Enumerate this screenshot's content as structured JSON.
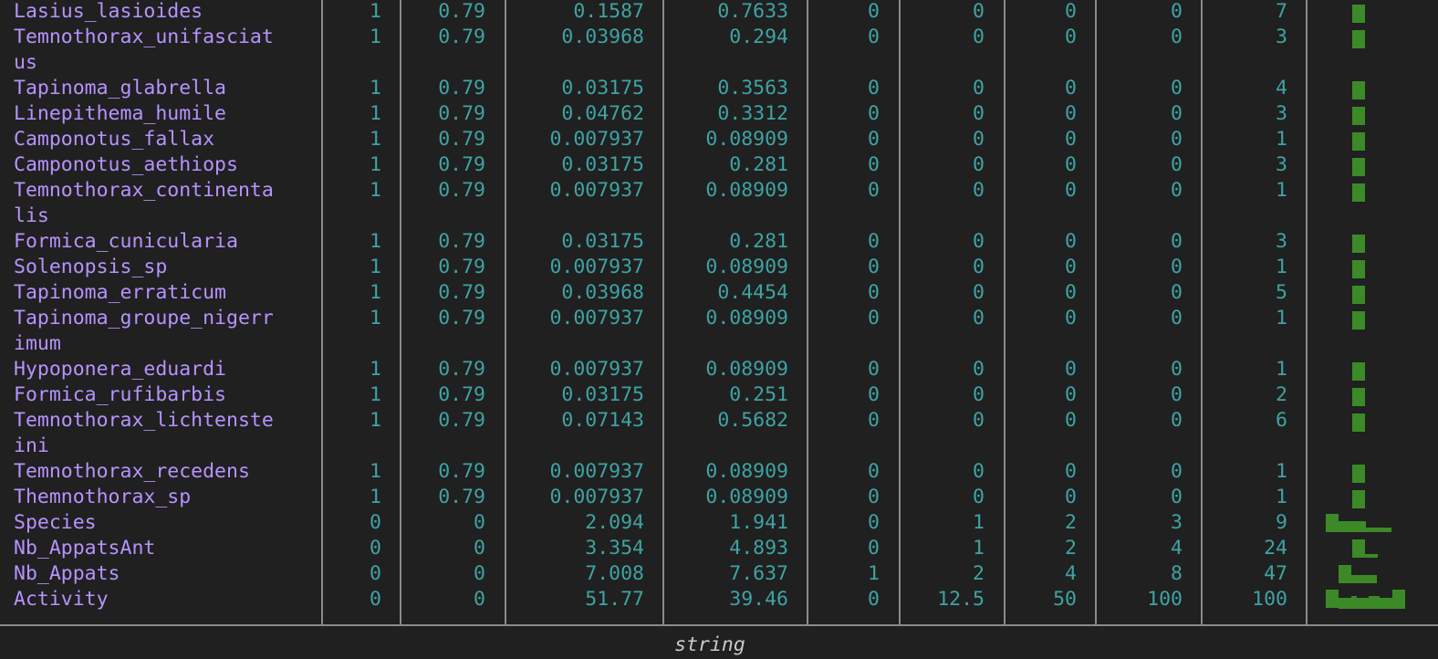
{
  "colors": {
    "background": "#202020",
    "row_label": "#b693ff",
    "numeric": "#3fa3a3",
    "histogram_bar": "#3c8a27",
    "grid_line": "#8a8a8a"
  },
  "rows": [
    {
      "name": [
        "Lasius_lasioides"
      ],
      "values": [
        "1",
        "0.79",
        "0.1587",
        "0.7633",
        "0",
        "0",
        "0",
        "0",
        "7"
      ],
      "hist": "single"
    },
    {
      "name": [
        "Temnothorax_unifasciat",
        "us"
      ],
      "values": [
        "1",
        "0.79",
        "0.03968",
        "0.294",
        "0",
        "0",
        "0",
        "0",
        "3"
      ],
      "hist": "single"
    },
    {
      "name": [
        "Tapinoma_glabrella"
      ],
      "values": [
        "1",
        "0.79",
        "0.03175",
        "0.3563",
        "0",
        "0",
        "0",
        "0",
        "4"
      ],
      "hist": "single"
    },
    {
      "name": [
        "Linepithema_humile"
      ],
      "values": [
        "1",
        "0.79",
        "0.04762",
        "0.3312",
        "0",
        "0",
        "0",
        "0",
        "3"
      ],
      "hist": "single"
    },
    {
      "name": [
        "Camponotus_fallax"
      ],
      "values": [
        "1",
        "0.79",
        "0.007937",
        "0.08909",
        "0",
        "0",
        "0",
        "0",
        "1"
      ],
      "hist": "single"
    },
    {
      "name": [
        "Camponotus_aethiops"
      ],
      "values": [
        "1",
        "0.79",
        "0.03175",
        "0.281",
        "0",
        "0",
        "0",
        "0",
        "3"
      ],
      "hist": "single"
    },
    {
      "name": [
        "Temnothorax_continenta",
        "lis"
      ],
      "values": [
        "1",
        "0.79",
        "0.007937",
        "0.08909",
        "0",
        "0",
        "0",
        "0",
        "1"
      ],
      "hist": "single"
    },
    {
      "name": [
        "Formica_cunicularia"
      ],
      "values": [
        "1",
        "0.79",
        "0.03175",
        "0.281",
        "0",
        "0",
        "0",
        "0",
        "3"
      ],
      "hist": "single"
    },
    {
      "name": [
        "Solenopsis_sp"
      ],
      "values": [
        "1",
        "0.79",
        "0.007937",
        "0.08909",
        "0",
        "0",
        "0",
        "0",
        "1"
      ],
      "hist": "single"
    },
    {
      "name": [
        "Tapinoma_erraticum"
      ],
      "values": [
        "1",
        "0.79",
        "0.03968",
        "0.4454",
        "0",
        "0",
        "0",
        "0",
        "5"
      ],
      "hist": "single"
    },
    {
      "name": [
        "Tapinoma_groupe_nigerr",
        "imum"
      ],
      "values": [
        "1",
        "0.79",
        "0.007937",
        "0.08909",
        "0",
        "0",
        "0",
        "0",
        "1"
      ],
      "hist": "single"
    },
    {
      "name": [
        "Hypoponera_eduardi"
      ],
      "values": [
        "1",
        "0.79",
        "0.007937",
        "0.08909",
        "0",
        "0",
        "0",
        "0",
        "1"
      ],
      "hist": "single"
    },
    {
      "name": [
        "Formica_rufibarbis"
      ],
      "values": [
        "1",
        "0.79",
        "0.03175",
        "0.251",
        "0",
        "0",
        "0",
        "0",
        "2"
      ],
      "hist": "single"
    },
    {
      "name": [
        "Temnothorax_lichtenste",
        "ini"
      ],
      "values": [
        "1",
        "0.79",
        "0.07143",
        "0.5682",
        "0",
        "0",
        "0",
        "0",
        "6"
      ],
      "hist": "single"
    },
    {
      "name": [
        "Temnothorax_recedens"
      ],
      "values": [
        "1",
        "0.79",
        "0.007937",
        "0.08909",
        "0",
        "0",
        "0",
        "0",
        "1"
      ],
      "hist": "single"
    },
    {
      "name": [
        "Themnothorax_sp"
      ],
      "values": [
        "1",
        "0.79",
        "0.007937",
        "0.08909",
        "0",
        "0",
        "0",
        "0",
        "1"
      ],
      "hist": "single"
    },
    {
      "name": [
        "Species"
      ],
      "values": [
        "0",
        "0",
        "2.094",
        "1.941",
        "0",
        "1",
        "2",
        "3",
        "9"
      ],
      "hist": "species"
    },
    {
      "name": [
        "Nb_AppatsAnt"
      ],
      "values": [
        "0",
        "0",
        "3.354",
        "4.893",
        "0",
        "1",
        "2",
        "4",
        "24"
      ],
      "hist": "nbappatsant"
    },
    {
      "name": [
        "Nb_Appats"
      ],
      "values": [
        "0",
        "0",
        "7.008",
        "7.637",
        "1",
        "2",
        "4",
        "8",
        "47"
      ],
      "hist": "nbappats"
    },
    {
      "name": [
        "Activity"
      ],
      "values": [
        "0",
        "0",
        "51.77",
        "39.46",
        "0",
        "12.5",
        "50",
        "100",
        "100"
      ],
      "hist": "activity"
    }
  ],
  "footer_text": "string"
}
